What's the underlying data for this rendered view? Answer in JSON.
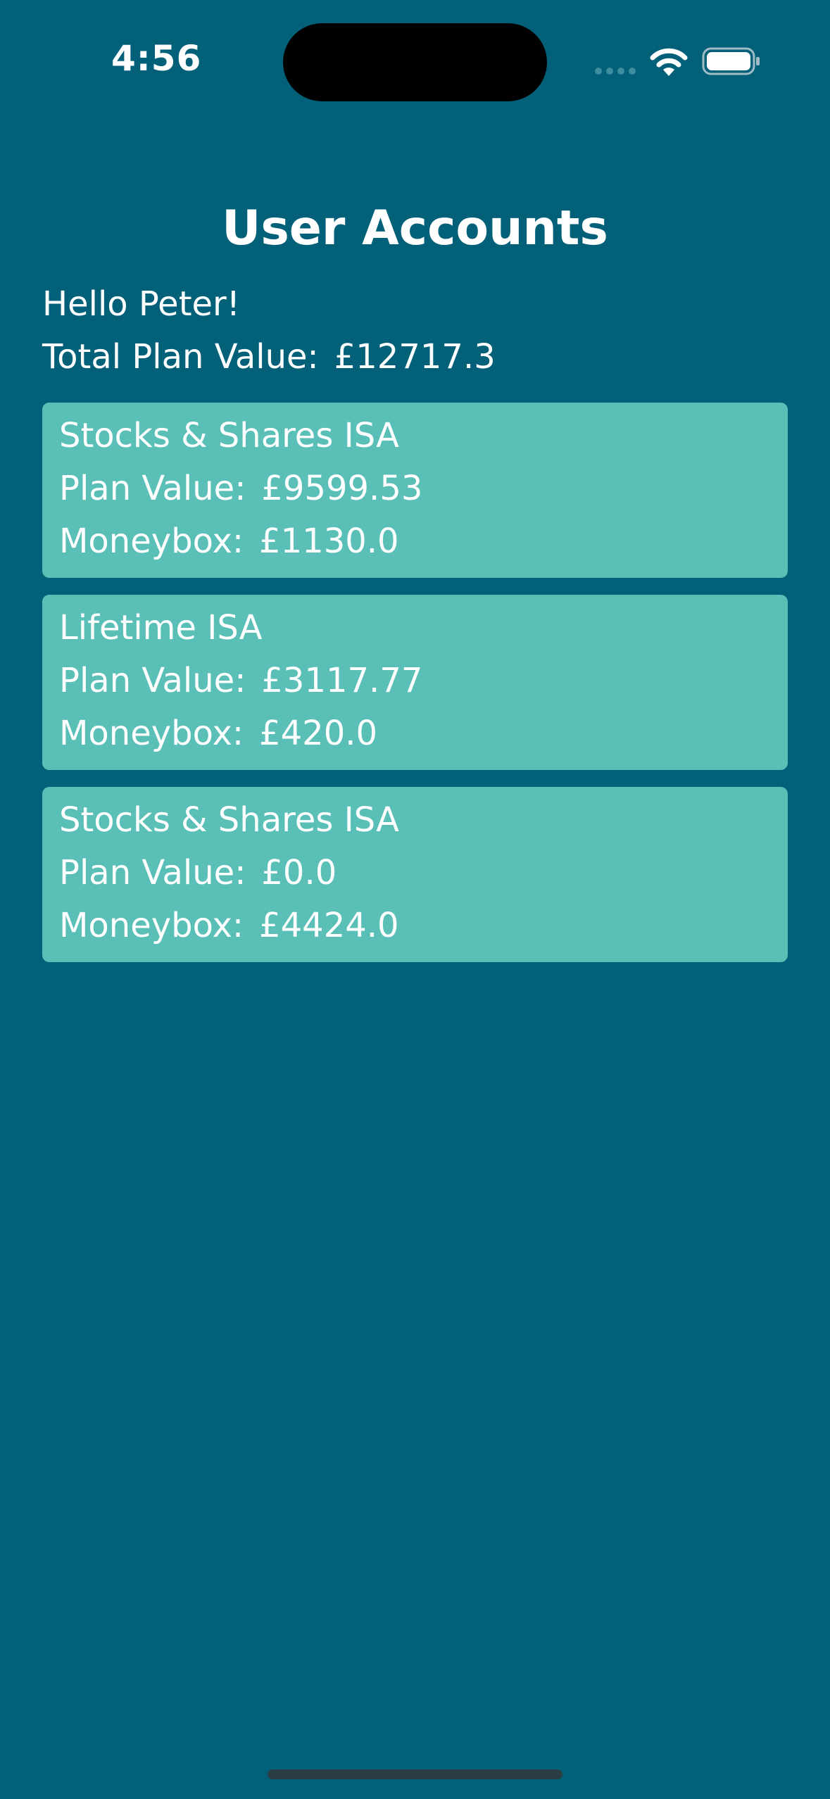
{
  "status_bar": {
    "time": "4:56",
    "icons": [
      "signal-dots-icon",
      "wifi-icon",
      "battery-icon"
    ]
  },
  "screen": {
    "title": "User Accounts",
    "greeting": "Hello Peter!",
    "total_label": "Total Plan Value:",
    "total_value": "£12717.3"
  },
  "accounts": [
    {
      "name": "Stocks & Shares ISA",
      "plan_value_label": "Plan Value:",
      "plan_value": "£9599.53",
      "moneybox_label": "Moneybox:",
      "moneybox": "£1130.0"
    },
    {
      "name": "Lifetime ISA",
      "plan_value_label": "Plan Value:",
      "plan_value": "£3117.77",
      "moneybox_label": "Moneybox:",
      "moneybox": "£420.0"
    },
    {
      "name": "Stocks & Shares ISA",
      "plan_value_label": "Plan Value:",
      "plan_value": "£0.0",
      "moneybox_label": "Moneybox:",
      "moneybox": "£4424.0"
    }
  ],
  "colors": {
    "background": "#026078",
    "card": "#5abfb6",
    "text": "#ffffff"
  }
}
